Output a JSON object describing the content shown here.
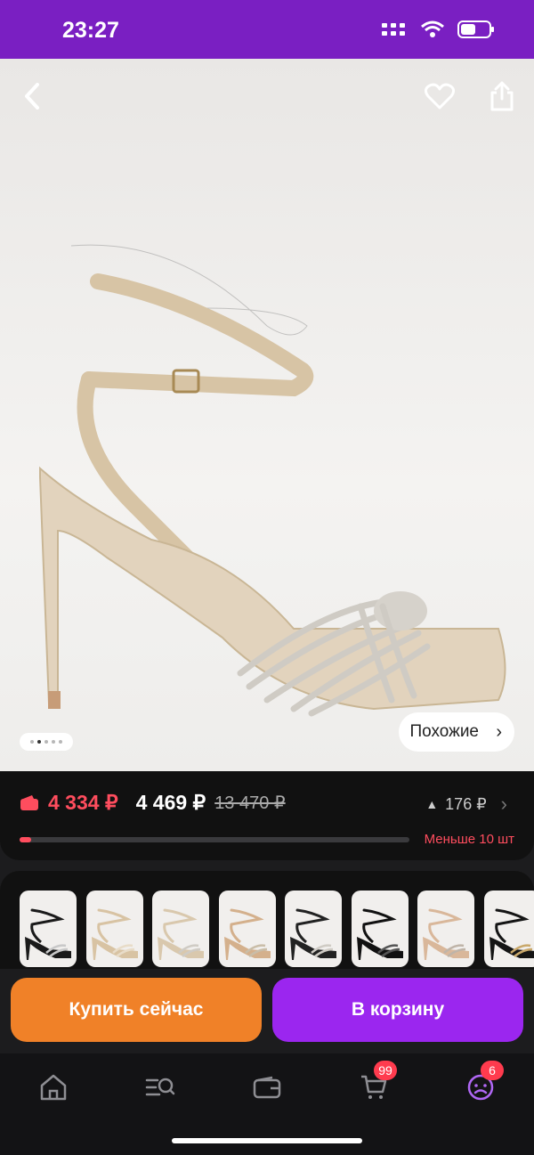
{
  "status": {
    "time": "23:27"
  },
  "gallery": {
    "similar_label": "Похожие",
    "dots": 5,
    "active_dot": 1
  },
  "price": {
    "main": "4 334 ₽",
    "second": "4 469 ₽",
    "old": "13 470 ₽",
    "diff": "176 ₽",
    "stock_text": "Меньше 10 шт",
    "stock_progress": 0.03
  },
  "variants": [
    "black-glitter",
    "beige",
    "beige-silver",
    "nude",
    "black-silver",
    "black",
    "nude-pink",
    "black-gold"
  ],
  "actions": {
    "buy_label": "Купить сейчас",
    "cart_label": "В корзину"
  },
  "tabbar": {
    "cart_badge": "99",
    "profile_badge": "6"
  },
  "colors": {
    "accent": "#9b26ef",
    "buy": "#f08128",
    "sale": "#ff4d5e",
    "status_bar": "#7a1fc2"
  }
}
